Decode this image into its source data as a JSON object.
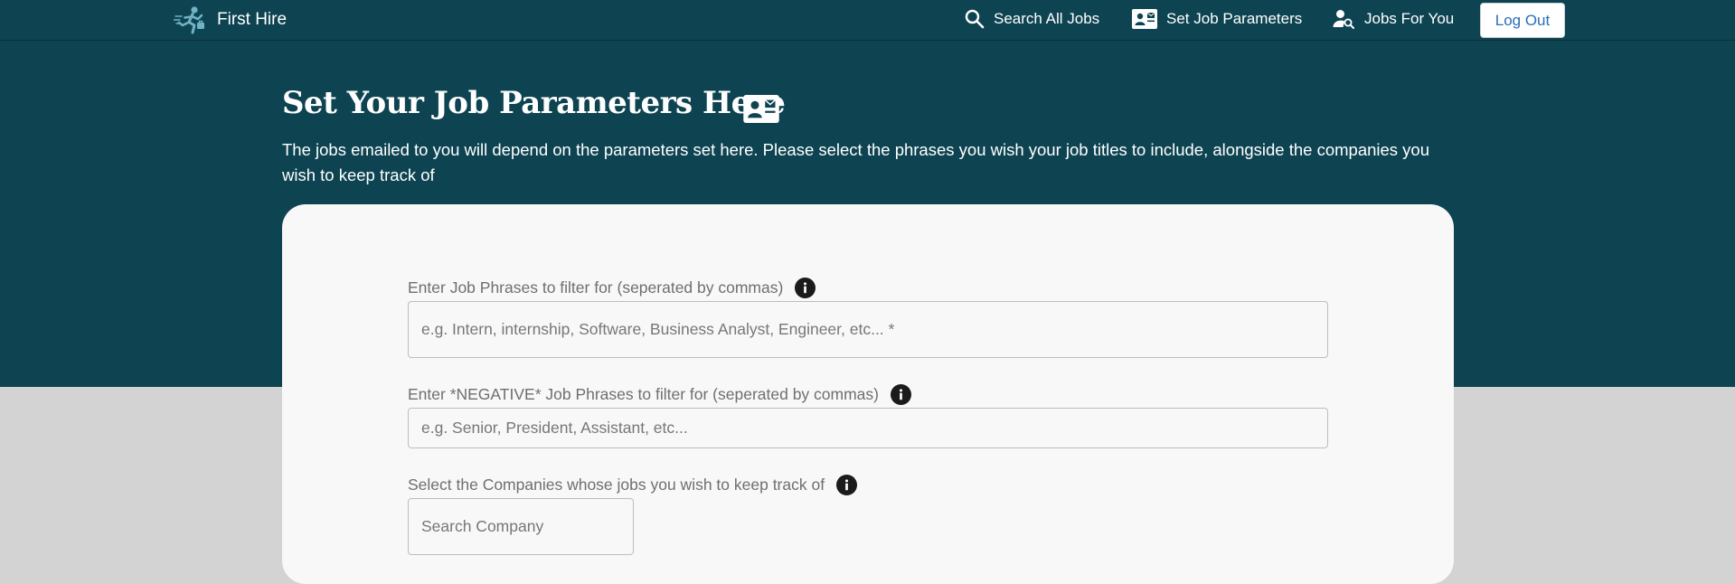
{
  "navbar": {
    "brand_name": "First Hire",
    "search_all_jobs": "Search All Jobs",
    "set_job_parameters": "Set Job Parameters",
    "jobs_for_you": "Jobs For You",
    "logout_label": "Log Out"
  },
  "header": {
    "title": "Set Your Job Parameters Here",
    "description": "The jobs emailed to you will depend on the parameters set here. Please select the phrases you wish your job titles to include, alongside the companies you wish to keep track of"
  },
  "form": {
    "job_phrases": {
      "label": "Enter Job Phrases to filter for (seperated by commas)",
      "placeholder": "e.g. Intern, internship, Software, Business Analyst, Engineer, etc... *",
      "value": ""
    },
    "negative_phrases": {
      "label": "Enter *NEGATIVE* Job Phrases to filter for (seperated by commas)",
      "placeholder": "e.g. Senior, President, Assistant, etc...",
      "value": ""
    },
    "companies": {
      "label": "Select the Companies whose jobs you wish to keep track of",
      "placeholder": "Search Company",
      "value": ""
    }
  },
  "icons": {
    "brand": "running-person-icon",
    "search": "search-icon",
    "parameters": "contact-card-icon",
    "jobs_for_you": "person-search-icon",
    "info": "info-icon"
  },
  "colors": {
    "header_bg": "#0e4452",
    "page_bg": "#d3d3d3",
    "card_bg": "#f8f8f8",
    "logout_text": "#2a6fb5",
    "brand_icon": "#6fb3c4"
  }
}
